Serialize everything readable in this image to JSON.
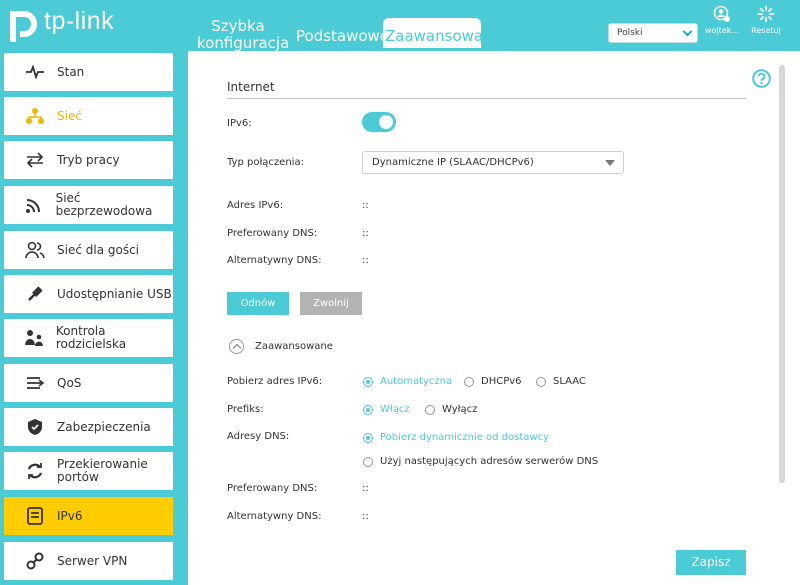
{
  "header": {
    "logo_text": "tp-link",
    "tabs": [
      {
        "label_line1": "Szybka",
        "label_line2": "konfiguracja"
      },
      {
        "label": "Podstawowe"
      },
      {
        "label": "Zaawansowane"
      }
    ],
    "language": "Polski",
    "user_label": "wojtek...",
    "reset_label": "Resetuj"
  },
  "sidebar": {
    "items": [
      {
        "label": "Stan",
        "icon": "pulse-icon"
      },
      {
        "label": "Sieć",
        "icon": "network-icon"
      },
      {
        "label": "Tryb pracy",
        "icon": "swap-icon"
      },
      {
        "label": "Sieć bezprzewodowa",
        "icon": "wireless-icon"
      },
      {
        "label": "Sieć dla gości",
        "icon": "guests-icon"
      },
      {
        "label": "Udostępnianie USB",
        "icon": "usb-icon"
      },
      {
        "label": "Kontrola rodzicielska",
        "icon": "family-icon"
      },
      {
        "label": "QoS",
        "icon": "qos-icon"
      },
      {
        "label": "Zabezpieczenia",
        "icon": "shield-icon"
      },
      {
        "label_line1": "Przekierowanie",
        "label_line2": "portów",
        "icon": "forward-icon"
      },
      {
        "label": "IPv6",
        "icon": "ipv6-icon"
      },
      {
        "label": "Serwer VPN",
        "icon": "vpn-icon"
      }
    ],
    "active": "IPv6"
  },
  "main": {
    "section_title": "Internet",
    "ipv6_label": "IPv6:",
    "ipv6_enabled": true,
    "connection_type_label": "Typ połączenia:",
    "connection_type_value": "Dynamiczne IP (SLAAC/DHCPv6)",
    "ipv6_address_label": "Adres IPv6:",
    "ipv6_address_value": "::",
    "preferred_dns_label": "Preferowany DNS:",
    "preferred_dns_value": "::",
    "alternate_dns_label": "Alternatywny DNS:",
    "alternate_dns_value": "::",
    "renew_label": "Odnów",
    "release_label": "Zwolnij",
    "advanced_label": "Zaawansowane",
    "get_address_label": "Pobierz adres IPv6:",
    "get_address_options": [
      "Automatyczna",
      "DHCPv6",
      "SLAAC"
    ],
    "get_address_selected": "Automatyczna",
    "prefix_label": "Prefiks:",
    "prefix_options": [
      "Włącz",
      "Wyłącz"
    ],
    "prefix_selected": "Włącz",
    "dns_addresses_label": "Adresy DNS:",
    "dns_options": [
      "Pobierz dynamicznie od dostawcy",
      "Użyj następujących adresów serwerów DNS"
    ],
    "dns_selected": "Pobierz dynamicznie od dostawcy",
    "adv_preferred_dns_label": "Preferowany DNS:",
    "adv_preferred_dns_value": "::",
    "adv_alternate_dns_label": "Alternatywny DNS:",
    "adv_alternate_dns_value": "::",
    "save_label": "Zapisz"
  },
  "colors": {
    "accent": "#4acbd6",
    "active_item": "#ffcc00",
    "disabled_button": "#b3b3b3"
  }
}
